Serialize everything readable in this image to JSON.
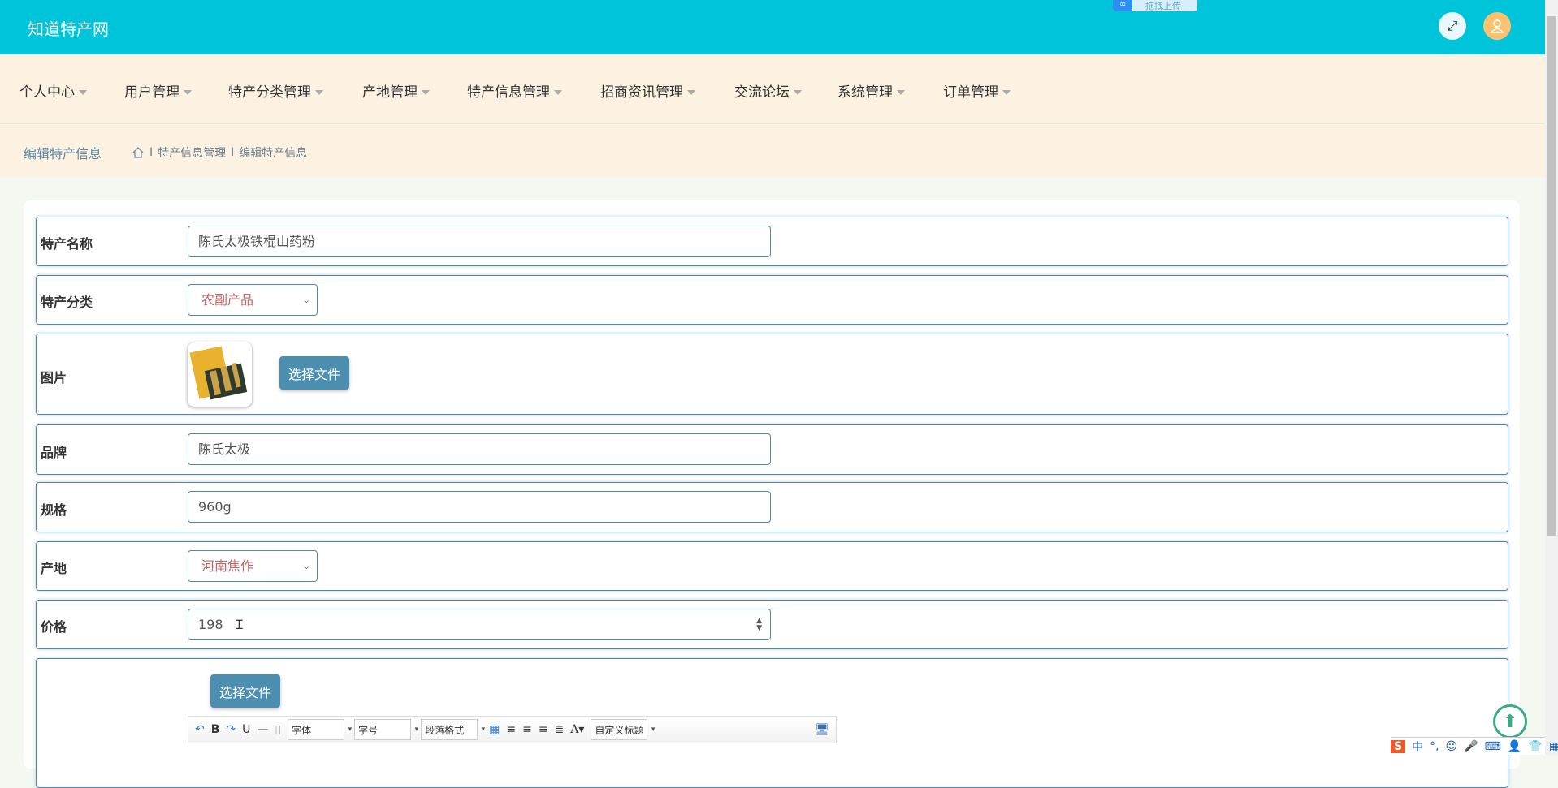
{
  "header": {
    "title": "知道特产网",
    "upload_badge": "拖拽上传",
    "upload_icon": "∞"
  },
  "nav": {
    "items": [
      {
        "label": "个人中心"
      },
      {
        "label": "用户管理"
      },
      {
        "label": "特产分类管理"
      },
      {
        "label": "产地管理"
      },
      {
        "label": "特产信息管理"
      },
      {
        "label": "招商资讯管理"
      },
      {
        "label": "交流论坛"
      },
      {
        "label": "系统管理"
      },
      {
        "label": "订单管理"
      }
    ]
  },
  "breadcrumb": {
    "title": "编辑特产信息",
    "items": [
      "特产信息管理",
      "编辑特产信息"
    ],
    "sep": "I"
  },
  "form": {
    "name": {
      "label": "特产名称",
      "value": "陈氏太极铁棍山药粉"
    },
    "category": {
      "label": "特产分类",
      "value": "农副产品"
    },
    "image": {
      "label": "图片",
      "button": "选择文件"
    },
    "brand": {
      "label": "品牌",
      "value": "陈氏太极"
    },
    "spec": {
      "label": "规格",
      "value": "960g"
    },
    "origin": {
      "label": "产地",
      "value": "河南焦作"
    },
    "price": {
      "label": "价格",
      "value": "198"
    },
    "detail": {
      "button": "选择文件",
      "toolbar": {
        "font": "字体",
        "size": "字号",
        "para": "段落格式",
        "custom": "自定义标题"
      }
    }
  },
  "ime": {
    "lang": "中",
    "punct": "°,"
  }
}
